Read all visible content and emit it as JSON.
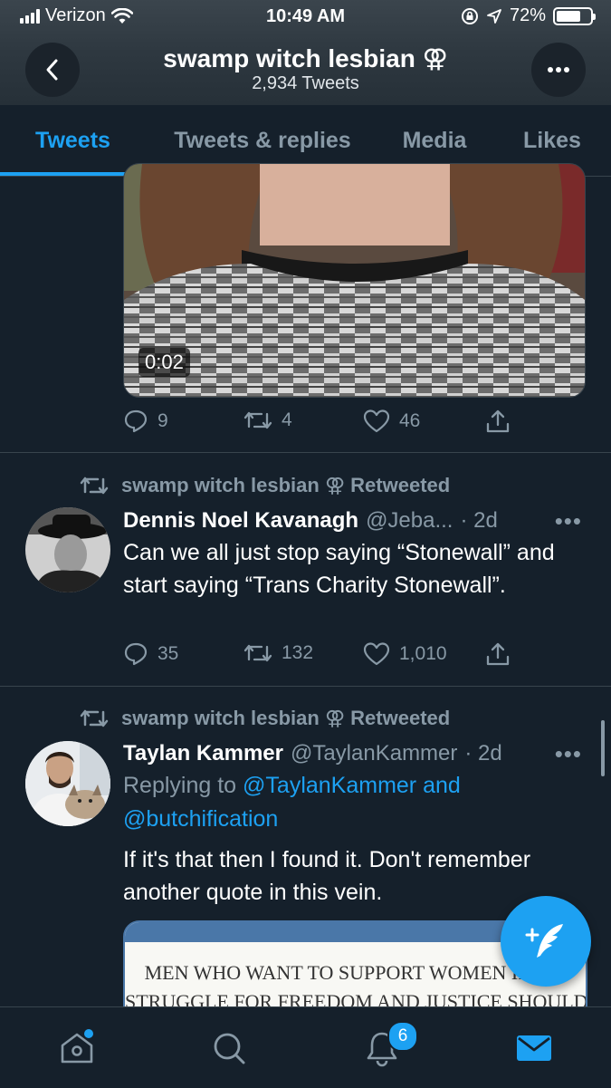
{
  "status_bar": {
    "carrier": "Verizon",
    "time": "10:49 AM",
    "battery": "72%",
    "battery_level": 0.72
  },
  "header": {
    "title": "swamp witch lesbian ⚢",
    "tweet_count": "2,934 Tweets"
  },
  "tabs": [
    {
      "label": "Tweets",
      "active": true
    },
    {
      "label": "Tweets & replies",
      "active": false
    },
    {
      "label": "Media",
      "active": false
    },
    {
      "label": "Likes",
      "active": false
    }
  ],
  "tweets": [
    {
      "video_duration": "0:02",
      "replies": "9",
      "retweets": "4",
      "likes": "46"
    },
    {
      "retweeted_by": "swamp witch lesbian ⚢ Retweeted",
      "name": "Dennis Noel Kavanagh",
      "handle": "@Jeba...",
      "time": "· 2d",
      "text": "Can we all just stop saying “Stonewall” and start saying “Trans Charity Stonewall”.",
      "replies": "35",
      "retweets": "132",
      "likes": "1,010"
    },
    {
      "retweeted_by": "swamp witch lesbian ⚢ Retweeted",
      "name": "Taylan Kammer",
      "handle": "@TaylanKammer",
      "time": "· 2d",
      "replying_prefix": "Replying to",
      "replying_users": "@TaylanKammer and @butchification",
      "text": "If it's that then I found it. Don't remember another quote in this vein.",
      "image_text_line1": "MEN WHO WANT TO SUPPORT WOMEN IN OU",
      "image_text_line2": "STRUGGLE FOR FREEDOM AND JUSTICE SHOULD"
    }
  ],
  "bottom_nav": {
    "notifications_badge": "6"
  },
  "colors": {
    "background": "#15202b",
    "accent": "#1da1f2",
    "muted": "#8899a6",
    "border": "#38444d"
  }
}
